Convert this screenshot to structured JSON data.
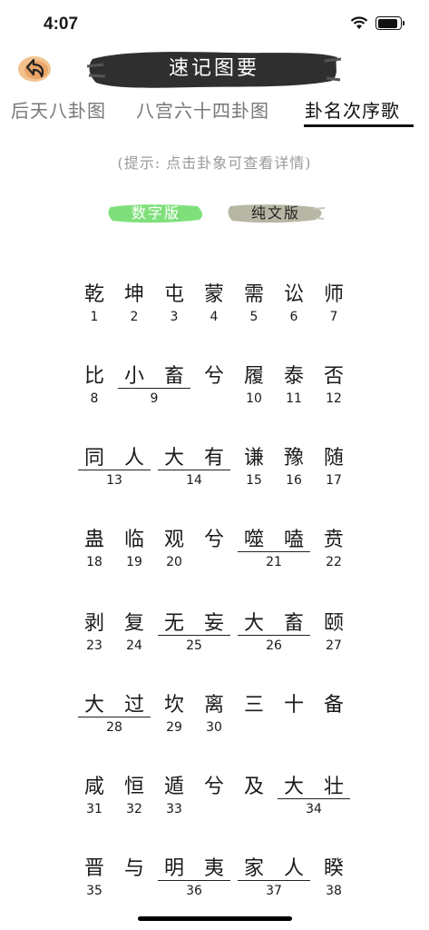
{
  "status": {
    "time": "4:07"
  },
  "header": {
    "title": "速记图要"
  },
  "tabs": [
    {
      "label": "后天八卦图",
      "active": false
    },
    {
      "label": "八宫六十四卦图",
      "active": false
    },
    {
      "label": "卦名次序歌",
      "active": true
    }
  ],
  "hint": "(提示: 点击卦象可查看详情)",
  "versions": [
    {
      "label": "数字版",
      "color": "#7fe07b",
      "text_color": "#ffffff"
    },
    {
      "label": "纯文版",
      "color": "#b8b6a4",
      "text_color": "#222222"
    }
  ],
  "rows": [
    {
      "chars": [
        "乾",
        "坤",
        "屯",
        "蒙",
        "需",
        "讼",
        "师"
      ],
      "groups": [
        {
          "start": 0,
          "span": 1,
          "num": "1"
        },
        {
          "start": 1,
          "span": 1,
          "num": "2"
        },
        {
          "start": 2,
          "span": 1,
          "num": "3"
        },
        {
          "start": 3,
          "span": 1,
          "num": "4"
        },
        {
          "start": 4,
          "span": 1,
          "num": "5"
        },
        {
          "start": 5,
          "span": 1,
          "num": "6"
        },
        {
          "start": 6,
          "span": 1,
          "num": "7"
        }
      ]
    },
    {
      "chars": [
        "比",
        "小",
        "畜",
        "兮",
        "履",
        "泰",
        "否"
      ],
      "groups": [
        {
          "start": 0,
          "span": 1,
          "num": "8"
        },
        {
          "start": 1,
          "span": 2,
          "num": "9"
        },
        {
          "start": 4,
          "span": 1,
          "num": "10"
        },
        {
          "start": 5,
          "span": 1,
          "num": "11"
        },
        {
          "start": 6,
          "span": 1,
          "num": "12"
        }
      ]
    },
    {
      "chars": [
        "同",
        "人",
        "大",
        "有",
        "谦",
        "豫",
        "随"
      ],
      "groups": [
        {
          "start": 0,
          "span": 2,
          "num": "13"
        },
        {
          "start": 2,
          "span": 2,
          "num": "14"
        },
        {
          "start": 4,
          "span": 1,
          "num": "15"
        },
        {
          "start": 5,
          "span": 1,
          "num": "16"
        },
        {
          "start": 6,
          "span": 1,
          "num": "17"
        }
      ]
    },
    {
      "chars": [
        "蛊",
        "临",
        "观",
        "兮",
        "噬",
        "嗑",
        "贲"
      ],
      "groups": [
        {
          "start": 0,
          "span": 1,
          "num": "18"
        },
        {
          "start": 1,
          "span": 1,
          "num": "19"
        },
        {
          "start": 2,
          "span": 1,
          "num": "20"
        },
        {
          "start": 4,
          "span": 2,
          "num": "21"
        },
        {
          "start": 6,
          "span": 1,
          "num": "22"
        }
      ]
    },
    {
      "chars": [
        "剥",
        "复",
        "无",
        "妄",
        "大",
        "畜",
        "颐"
      ],
      "groups": [
        {
          "start": 0,
          "span": 1,
          "num": "23"
        },
        {
          "start": 1,
          "span": 1,
          "num": "24"
        },
        {
          "start": 2,
          "span": 2,
          "num": "25"
        },
        {
          "start": 4,
          "span": 2,
          "num": "26"
        },
        {
          "start": 6,
          "span": 1,
          "num": "27"
        }
      ]
    },
    {
      "chars": [
        "大",
        "过",
        "坎",
        "离",
        "三",
        "十",
        "备"
      ],
      "groups": [
        {
          "start": 0,
          "span": 2,
          "num": "28"
        },
        {
          "start": 2,
          "span": 1,
          "num": "29"
        },
        {
          "start": 3,
          "span": 1,
          "num": "30"
        }
      ]
    },
    {
      "chars": [
        "咸",
        "恒",
        "遁",
        "兮",
        "及",
        "大",
        "壮"
      ],
      "groups": [
        {
          "start": 0,
          "span": 1,
          "num": "31"
        },
        {
          "start": 1,
          "span": 1,
          "num": "32"
        },
        {
          "start": 2,
          "span": 1,
          "num": "33"
        },
        {
          "start": 5,
          "span": 2,
          "num": "34"
        }
      ]
    },
    {
      "chars": [
        "晋",
        "与",
        "明",
        "夷",
        "家",
        "人",
        "睽"
      ],
      "groups": [
        {
          "start": 0,
          "span": 1,
          "num": "35"
        },
        {
          "start": 2,
          "span": 2,
          "num": "36"
        },
        {
          "start": 4,
          "span": 2,
          "num": "37"
        },
        {
          "start": 6,
          "span": 1,
          "num": "38"
        }
      ]
    }
  ]
}
